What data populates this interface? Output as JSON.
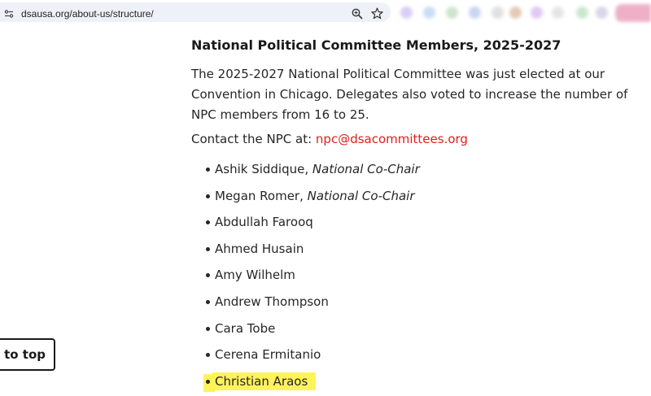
{
  "browser": {
    "url": "dsausa.org/about-us/structure/"
  },
  "colors": {
    "link": "#e0201b",
    "highlight": "#fff35a",
    "text": "#262626"
  },
  "main": {
    "heading": "National Political Committee Members, 2025-2027",
    "intro": "The 2025-2027 National Political Committee was just elected at our Convention in Chicago. Delegates also voted to increase the number of NPC members from 16 to 25.",
    "contact_prefix": "Contact the NPC at: ",
    "contact_email": "npc@dsacommittees.org",
    "members": [
      {
        "name": "Ashik Siddique, ",
        "role": "National Co-Chair"
      },
      {
        "name": "Megan Romer, ",
        "role": "National Co-Chair"
      },
      {
        "name": "Abdullah Farooq"
      },
      {
        "name": "Ahmed Husain"
      },
      {
        "name": "Amy Wilhelm"
      },
      {
        "name": "Andrew Thompson"
      },
      {
        "name": "Cara Tobe"
      },
      {
        "name": "Cerena Ermitanio"
      },
      {
        "name": "Christian Araos"
      }
    ]
  },
  "back_to_top": {
    "label": "ck to top"
  }
}
